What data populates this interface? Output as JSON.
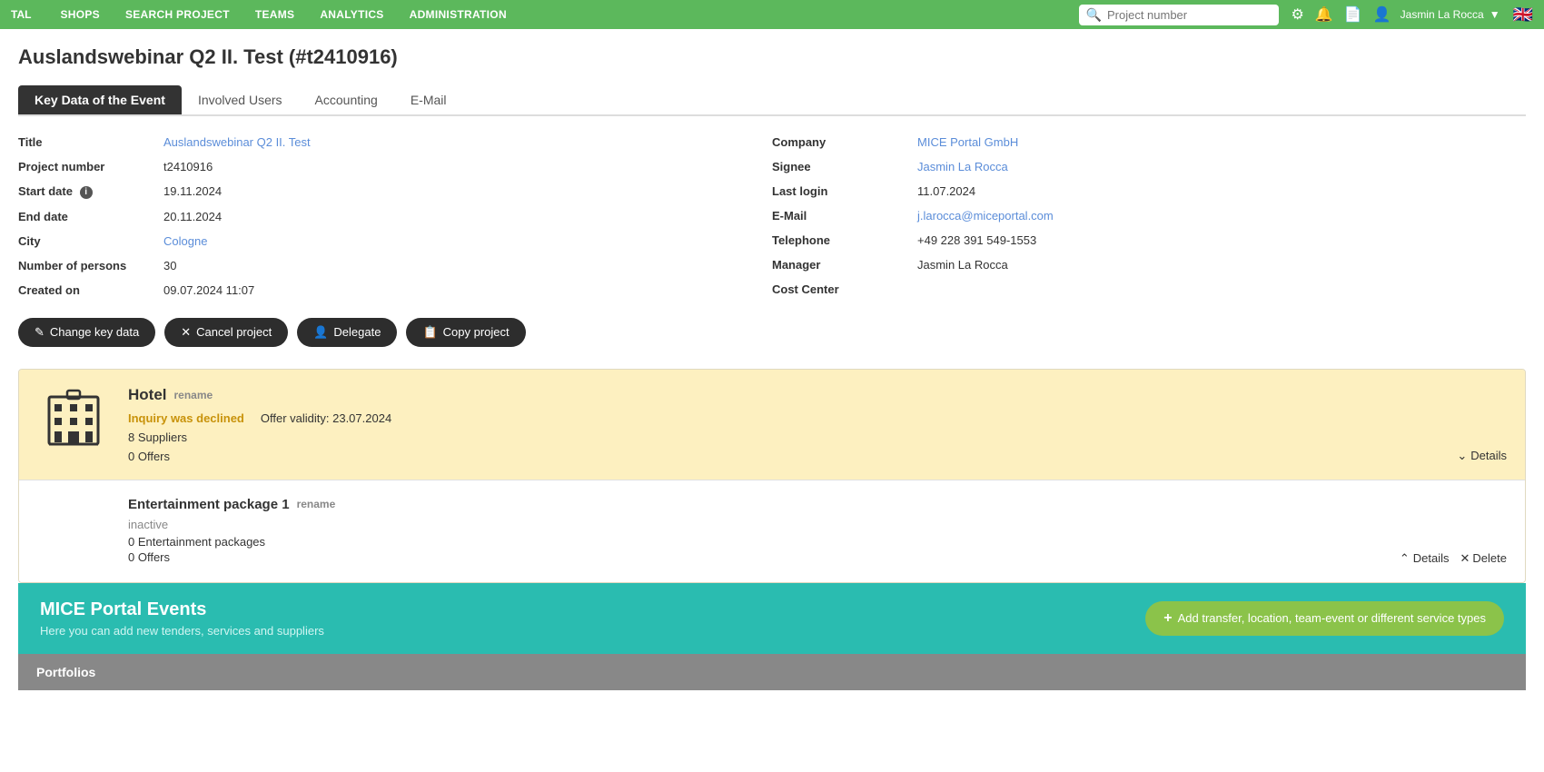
{
  "nav": {
    "brand": "TAL",
    "items": [
      "SHOPS",
      "SEARCH PROJECT",
      "TEAMS",
      "ANALYTICS",
      "ADMINISTRATION"
    ],
    "search_placeholder": "Project number",
    "user_name": "Jasmin La Rocca"
  },
  "page": {
    "title": "Auslandswebinar Q2 II. Test (#t2410916)"
  },
  "tabs": {
    "items": [
      "Key Data of the Event",
      "Involved Users",
      "Accounting",
      "E-Mail"
    ],
    "active": "Key Data of the Event"
  },
  "key_data": {
    "left": {
      "title_label": "Title",
      "title_value": "Auslandswebinar Q2 II. Test",
      "project_number_label": "Project number",
      "project_number_value": "t2410916",
      "start_date_label": "Start date",
      "start_date_value": "19.11.2024",
      "end_date_label": "End date",
      "end_date_value": "20.11.2024",
      "city_label": "City",
      "city_value": "Cologne",
      "persons_label": "Number of persons",
      "persons_value": "30",
      "created_label": "Created on",
      "created_value": "09.07.2024 11:07"
    },
    "right": {
      "company_label": "Company",
      "company_value": "MICE Portal GmbH",
      "signee_label": "Signee",
      "signee_value": "Jasmin La Rocca",
      "last_login_label": "Last login",
      "last_login_value": "11.07.2024",
      "email_label": "E-Mail",
      "email_value": "j.larocca@miceportal.com",
      "telephone_label": "Telephone",
      "telephone_value": "+49 228 391 549-1553",
      "manager_label": "Manager",
      "manager_value": "Jasmin La Rocca",
      "cost_center_label": "Cost Center",
      "cost_center_value": ""
    }
  },
  "action_buttons": {
    "change_key_data": "Change key data",
    "cancel_project": "Cancel project",
    "delegate": "Delegate",
    "copy_project": "Copy project"
  },
  "hotel_section": {
    "title": "Hotel",
    "rename": "rename",
    "inquiry_status": "Inquiry was declined",
    "offer_validity": "Offer validity: 23.07.2024",
    "suppliers": "8 Suppliers",
    "offers": "0 Offers",
    "details": "Details"
  },
  "entertainment_section": {
    "title": "Entertainment package 1",
    "rename": "rename",
    "status": "inactive",
    "packages": "0 Entertainment packages",
    "offers": "0 Offers",
    "details": "Details",
    "delete": "Delete"
  },
  "mice_banner": {
    "title": "MICE Portal Events",
    "subtitle": "Here you can add new tenders, services and suppliers",
    "add_button": "Add transfer, location, team-event or different service types"
  },
  "portfolios": {
    "title": "Portfolios"
  }
}
